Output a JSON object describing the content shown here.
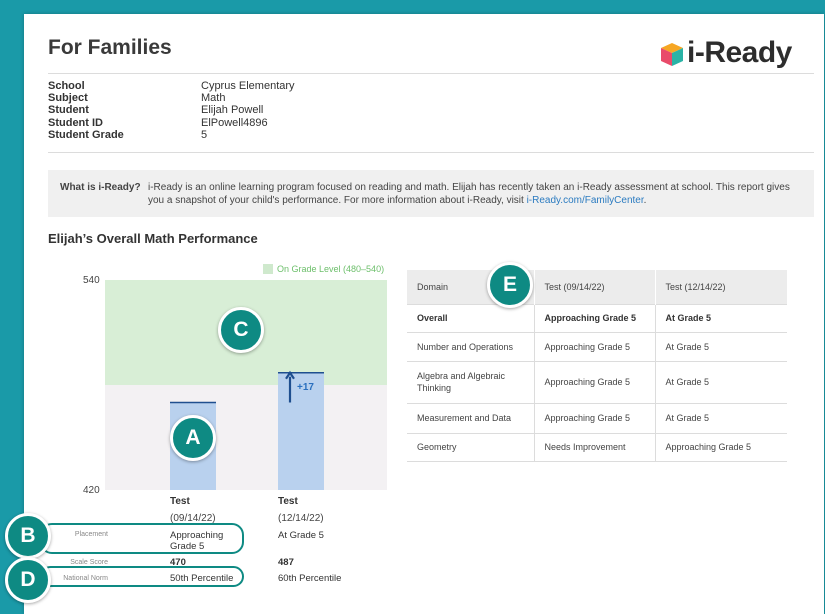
{
  "header": {
    "title": "For Families",
    "logo_text": "i-Ready"
  },
  "student_info": [
    {
      "label": "School",
      "value": "Cyprus Elementary"
    },
    {
      "label": "Subject",
      "value": "Math"
    },
    {
      "label": "Student",
      "value": "Elijah Powell"
    },
    {
      "label": "Student ID",
      "value": "ElPowell4896"
    },
    {
      "label": "Student Grade",
      "value": "5"
    }
  ],
  "about": {
    "label": "What is i-Ready?",
    "text": "i-Ready is an online learning program focused on reading and math. Elijah has recently taken an i-Ready assessment at school. This report gives you a snapshot of your child's performance. For more information about i-Ready, visit ",
    "link": "i-Ready.com/FamilyCenter",
    "end": "."
  },
  "performance": {
    "title": "Elijah’s Overall Math Performance",
    "legend": "On Grade Level (480–540)",
    "change_label": "+17",
    "tests": [
      {
        "head": "Test",
        "date": "(09/14/22)",
        "placement": "Approaching Grade 5",
        "scale": "470",
        "norm": "50th Percentile"
      },
      {
        "head": "Test",
        "date": "(12/14/22)",
        "placement": "At Grade 5",
        "scale": "487",
        "norm": "60th Percentile"
      }
    ],
    "row_labels": {
      "placement": "Placement",
      "scale": "Scale Score",
      "norm": "National Norm"
    }
  },
  "chart_data": {
    "type": "bar",
    "categories": [
      "Test (09/14/22)",
      "Test (12/14/22)"
    ],
    "values": [
      470,
      487
    ],
    "ylim": [
      420,
      540
    ],
    "yticks": [
      420,
      540
    ],
    "band": [
      480,
      540
    ],
    "xlabel": "",
    "ylabel": "",
    "title": ""
  },
  "badges": {
    "a": "A",
    "b": "B",
    "c": "C",
    "d": "D",
    "e": "E"
  },
  "domain_table": {
    "headers": [
      "Domain",
      "Test (09/14/22)",
      "Test (12/14/22)"
    ],
    "rows": [
      [
        "Overall",
        "Approaching Grade 5",
        "At Grade 5"
      ],
      [
        "Number and Operations",
        "Approaching Grade 5",
        "At Grade 5"
      ],
      [
        "Algebra and Algebraic Thinking",
        "Approaching Grade 5",
        "At Grade 5"
      ],
      [
        "Measurement and Data",
        "Approaching Grade 5",
        "At Grade 5"
      ],
      [
        "Geometry",
        "Needs Improvement",
        "Approaching Grade 5"
      ]
    ]
  },
  "colors": {
    "page_bg": "#1a9aa8",
    "badge": "#0e8a83",
    "band": "#d8eed6",
    "bar": "#b9d1ee",
    "bar_line": "#1f4f8f",
    "link": "#2b7bc0"
  }
}
